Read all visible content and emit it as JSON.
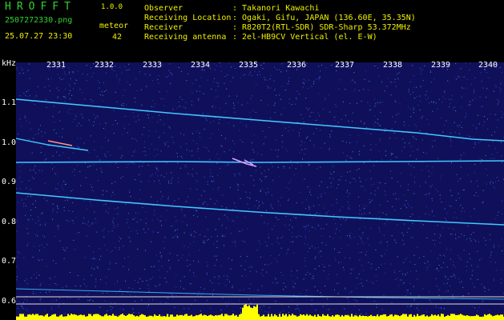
{
  "app": {
    "title": "HROFFT",
    "version": "1.0.0"
  },
  "file": {
    "name": "2507272330.png",
    "datetime": "25.07.27 23:30"
  },
  "meteor": {
    "label": "meteor",
    "count": "42"
  },
  "info": [
    {
      "label": "Observer",
      "value": ": Takanori Kawachi"
    },
    {
      "label": "Receiving Location",
      "value": ": Ogaki, Gifu, JAPAN (136.60E, 35.35N)"
    },
    {
      "label": "Receiver",
      "value": ": R820T2(RTL-SDR) SDR-Sharp 53.372MHz"
    },
    {
      "label": "Receiving antenna",
      "value": ": 2el-HB9CV Vertical (el. E-W)"
    }
  ],
  "axis": {
    "y_unit": "kHz",
    "y_ticks": [
      "1.1",
      "1.0",
      "0.9",
      "0.8",
      "0.7",
      "0.6"
    ],
    "x_ticks": [
      "2331",
      "2332",
      "2333",
      "2334",
      "2335",
      "2336",
      "2337",
      "2338",
      "2339",
      "2340"
    ]
  },
  "colors": {
    "header_green": "#2fd52f",
    "header_yellow": "#f0f000",
    "background": "#10105a",
    "trace": "#40c8ff",
    "level_bar": "#ffff00"
  }
}
